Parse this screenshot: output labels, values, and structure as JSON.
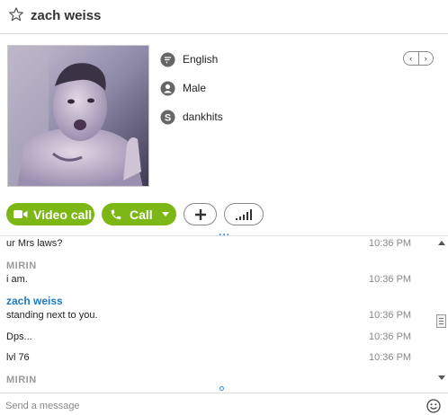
{
  "header": {
    "title": "zach weiss",
    "favorite_icon": "star-outline-icon"
  },
  "profile": {
    "avatar": "profile-photo",
    "details": [
      {
        "icon": "speech-bubble-icon",
        "label": "English"
      },
      {
        "icon": "person-icon",
        "label": "Male"
      },
      {
        "icon": "skype-icon",
        "label": "dankhits"
      }
    ],
    "pager": {
      "prev": "‹",
      "next": "›"
    }
  },
  "actions": {
    "video_call": "Video call",
    "call": "Call",
    "add_icon": "plus-icon",
    "signal_icon": "signal-bars-icon",
    "more": "..."
  },
  "colors": {
    "call_green": "#7cb715",
    "sender_blue": "#1e7bc3",
    "sender_gray": "#9a9a9a"
  },
  "messages": [
    {
      "text": "ur Mrs laws?",
      "time": "10:36 PM"
    },
    {
      "sender": "MIRIN"
    },
    {
      "text": "i am.",
      "time": "10:36 PM"
    },
    {
      "sender": "zach weiss"
    },
    {
      "text": "standing next to you.",
      "time": "10:36 PM"
    },
    {
      "text": "Dps...",
      "time": "10:36 PM"
    },
    {
      "text": "lvl 76",
      "time": "10:36 PM"
    },
    {
      "sender": "MIRIN"
    }
  ],
  "composer": {
    "placeholder": "Send a message",
    "emoji_icon": "smiley-icon"
  }
}
